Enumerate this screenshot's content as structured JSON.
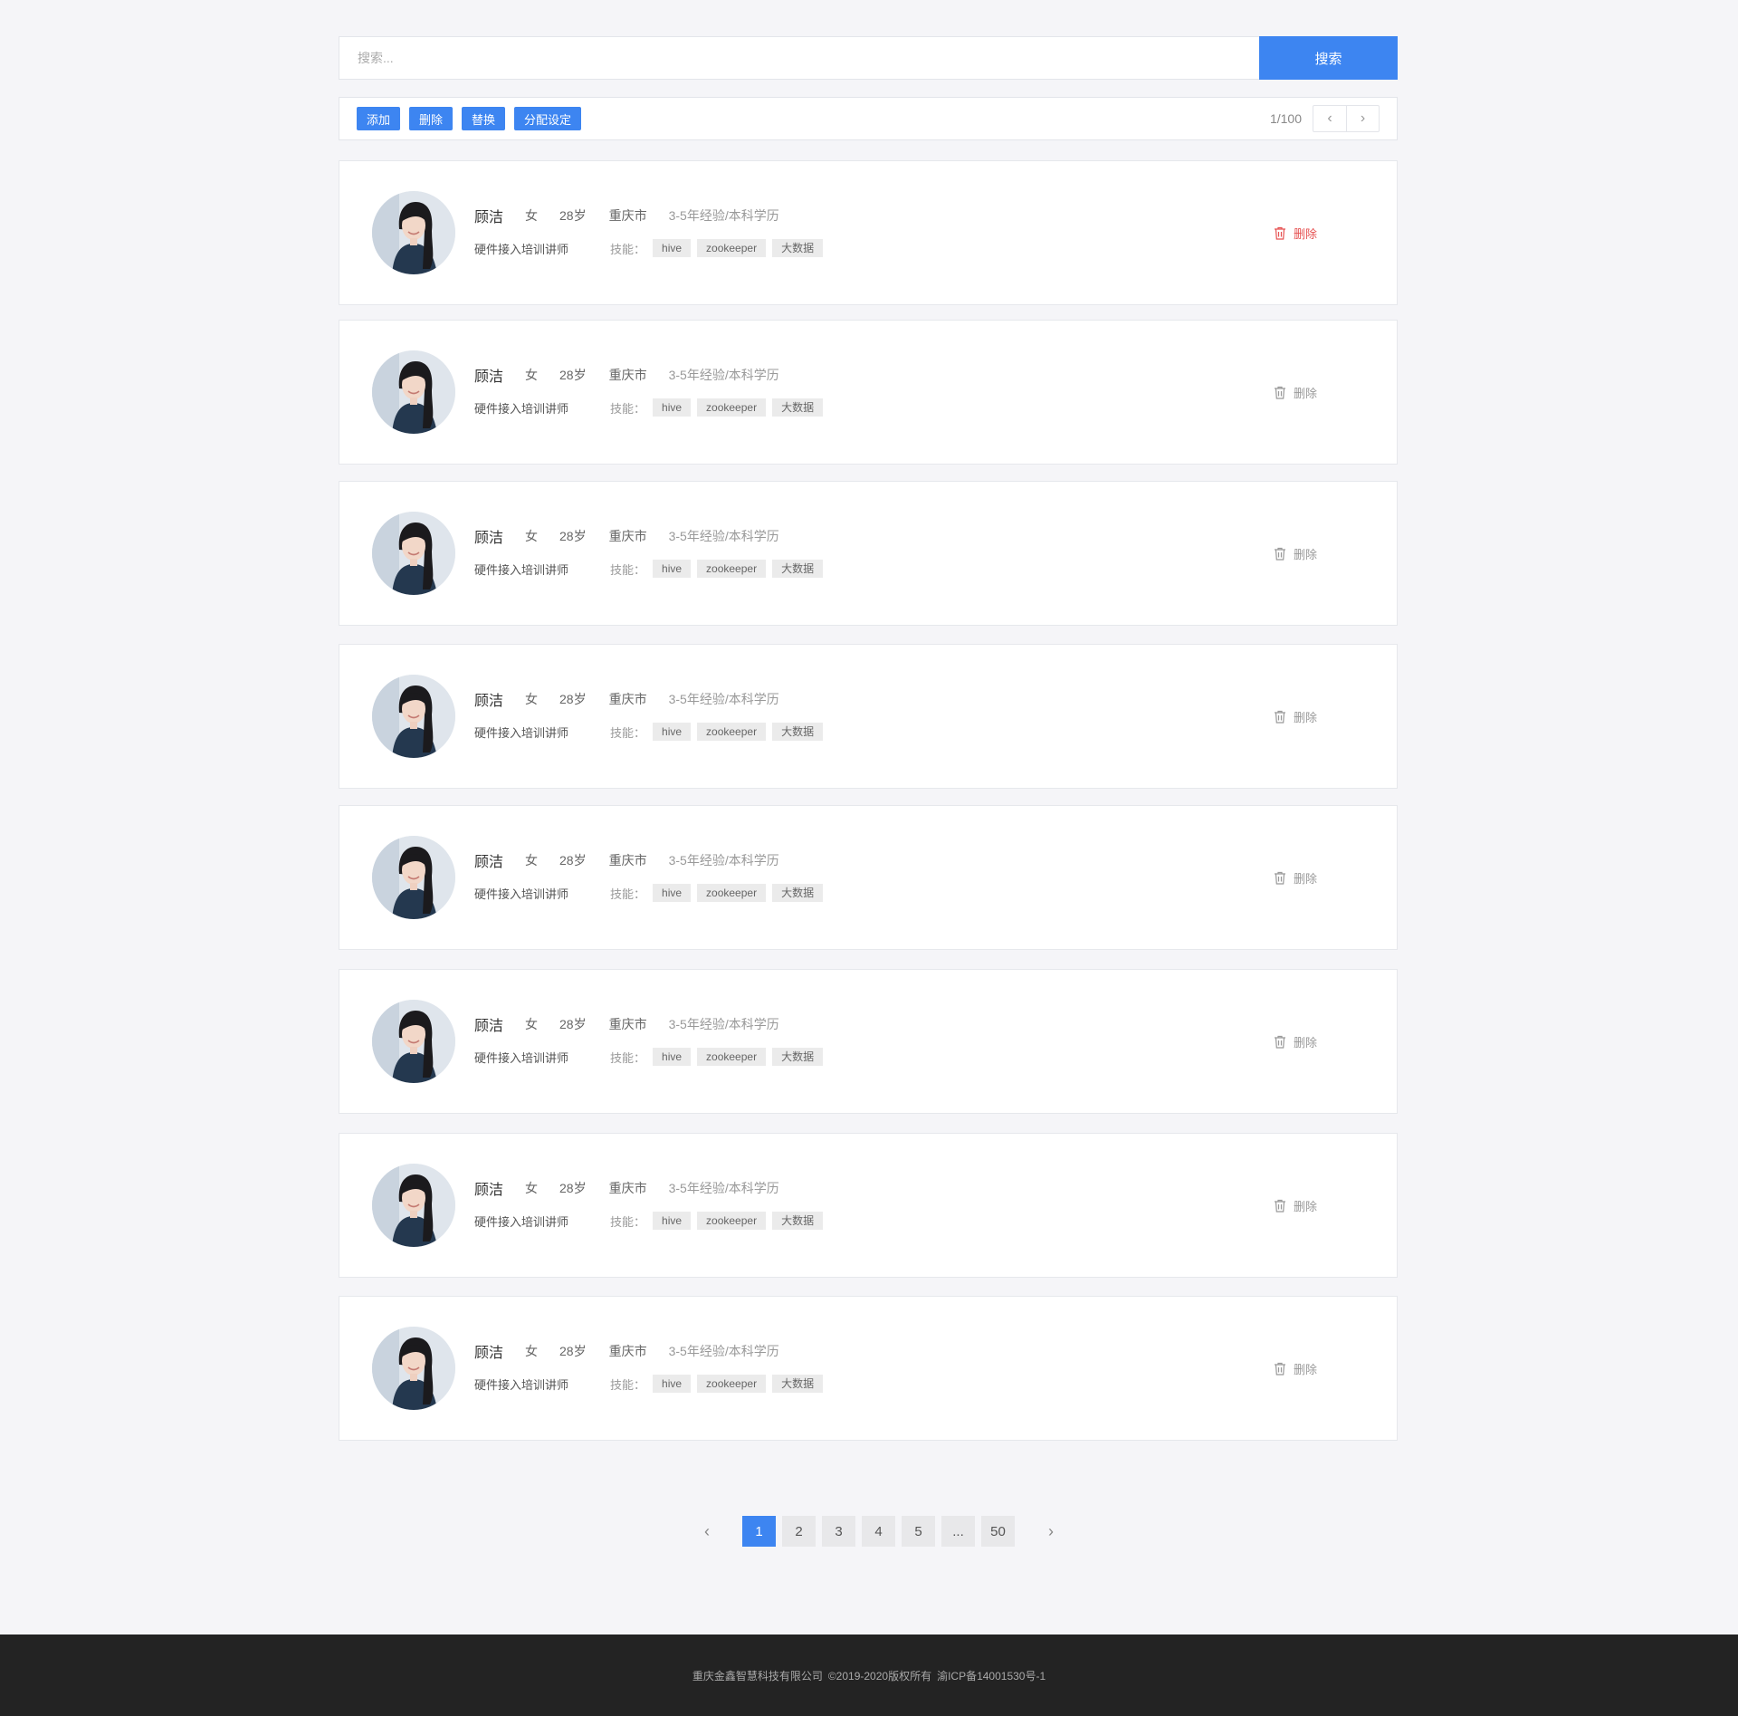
{
  "search": {
    "placeholder": "搜索...",
    "button_label": "搜索"
  },
  "toolbar": {
    "buttons": [
      "添加",
      "删除",
      "替换",
      "分配设定"
    ],
    "page_count": "1/100",
    "prev_icon": "chevron-left-icon",
    "next_icon": "chevron-right-icon"
  },
  "candidates": [
    {
      "name": "顾洁",
      "gender": "女",
      "age": "28岁",
      "city": "重庆市",
      "experience": "3-5年经验/本科学历",
      "title": "硬件接入培训讲师",
      "skills_label": "技能：",
      "skills": [
        "hive",
        "zookeeper",
        "大数据"
      ],
      "delete_label": "删除",
      "delete_active": true
    },
    {
      "name": "顾洁",
      "gender": "女",
      "age": "28岁",
      "city": "重庆市",
      "experience": "3-5年经验/本科学历",
      "title": "硬件接入培训讲师",
      "skills_label": "技能：",
      "skills": [
        "hive",
        "zookeeper",
        "大数据"
      ],
      "delete_label": "删除",
      "delete_active": false
    },
    {
      "name": "顾洁",
      "gender": "女",
      "age": "28岁",
      "city": "重庆市",
      "experience": "3-5年经验/本科学历",
      "title": "硬件接入培训讲师",
      "skills_label": "技能：",
      "skills": [
        "hive",
        "zookeeper",
        "大数据"
      ],
      "delete_label": "删除",
      "delete_active": false
    },
    {
      "name": "顾洁",
      "gender": "女",
      "age": "28岁",
      "city": "重庆市",
      "experience": "3-5年经验/本科学历",
      "title": "硬件接入培训讲师",
      "skills_label": "技能：",
      "skills": [
        "hive",
        "zookeeper",
        "大数据"
      ],
      "delete_label": "删除",
      "delete_active": false
    },
    {
      "name": "顾洁",
      "gender": "女",
      "age": "28岁",
      "city": "重庆市",
      "experience": "3-5年经验/本科学历",
      "title": "硬件接入培训讲师",
      "skills_label": "技能：",
      "skills": [
        "hive",
        "zookeeper",
        "大数据"
      ],
      "delete_label": "删除",
      "delete_active": false
    },
    {
      "name": "顾洁",
      "gender": "女",
      "age": "28岁",
      "city": "重庆市",
      "experience": "3-5年经验/本科学历",
      "title": "硬件接入培训讲师",
      "skills_label": "技能：",
      "skills": [
        "hive",
        "zookeeper",
        "大数据"
      ],
      "delete_label": "删除",
      "delete_active": false
    },
    {
      "name": "顾洁",
      "gender": "女",
      "age": "28岁",
      "city": "重庆市",
      "experience": "3-5年经验/本科学历",
      "title": "硬件接入培训讲师",
      "skills_label": "技能：",
      "skills": [
        "hive",
        "zookeeper",
        "大数据"
      ],
      "delete_label": "删除",
      "delete_active": false
    },
    {
      "name": "顾洁",
      "gender": "女",
      "age": "28岁",
      "city": "重庆市",
      "experience": "3-5年经验/本科学历",
      "title": "硬件接入培训讲师",
      "skills_label": "技能：",
      "skills": [
        "hive",
        "zookeeper",
        "大数据"
      ],
      "delete_label": "删除",
      "delete_active": false
    }
  ],
  "pagination": {
    "pages": [
      "1",
      "2",
      "3",
      "4",
      "5",
      "...",
      "50"
    ],
    "current": "1",
    "prev_icon": "chevron-left-icon",
    "next_icon": "chevron-right-icon"
  },
  "footer": {
    "company": "重庆金鑫智慧科技有限公司",
    "copyright": "©2019-2020版权所有",
    "icp": "渝ICP备14001530号-1"
  },
  "colors": {
    "primary": "#3d85f1",
    "danger": "#e65252",
    "footer_bg": "#232323",
    "page_bg": "#f5f5f8"
  }
}
